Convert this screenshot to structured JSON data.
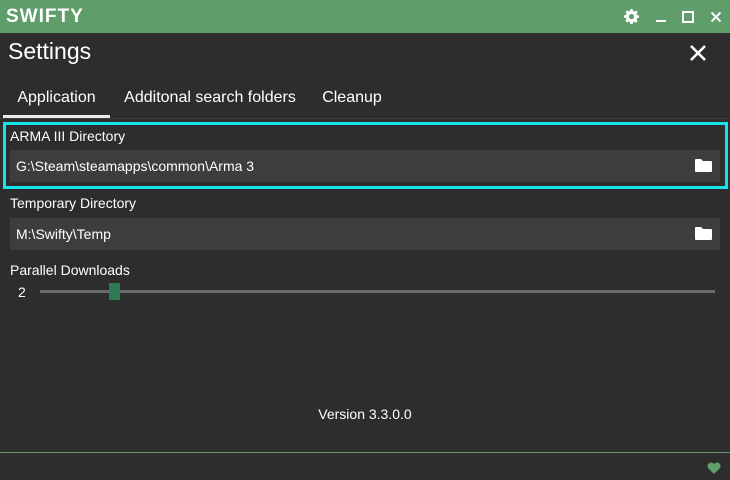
{
  "window": {
    "app_title": "SWIFTY",
    "accent_color": "#5f9d6a",
    "highlight_color": "#17e3ea",
    "icons": [
      "gear-icon",
      "minimize-icon",
      "maximize-icon",
      "close-icon"
    ]
  },
  "header": {
    "title": "Settings",
    "close_icon": "close-icon"
  },
  "tabs": [
    {
      "label": "Application",
      "active": true
    },
    {
      "label": "Additonal search folders",
      "active": false
    },
    {
      "label": "Cleanup",
      "active": false
    }
  ],
  "fields": {
    "arma_dir": {
      "label": "ARMA III Directory",
      "value": "G:\\Steam\\steamapps\\common\\Arma 3",
      "icon": "folder-icon"
    },
    "temp_dir": {
      "label": "Temporary Directory",
      "value": "M:\\Swifty\\Temp",
      "icon": "folder-icon"
    }
  },
  "parallel_downloads": {
    "label": "Parallel Downloads",
    "value": "2",
    "level": 0.11
  },
  "footer": {
    "version": "Version 3.3.0.0",
    "icon": "heart-icon"
  }
}
